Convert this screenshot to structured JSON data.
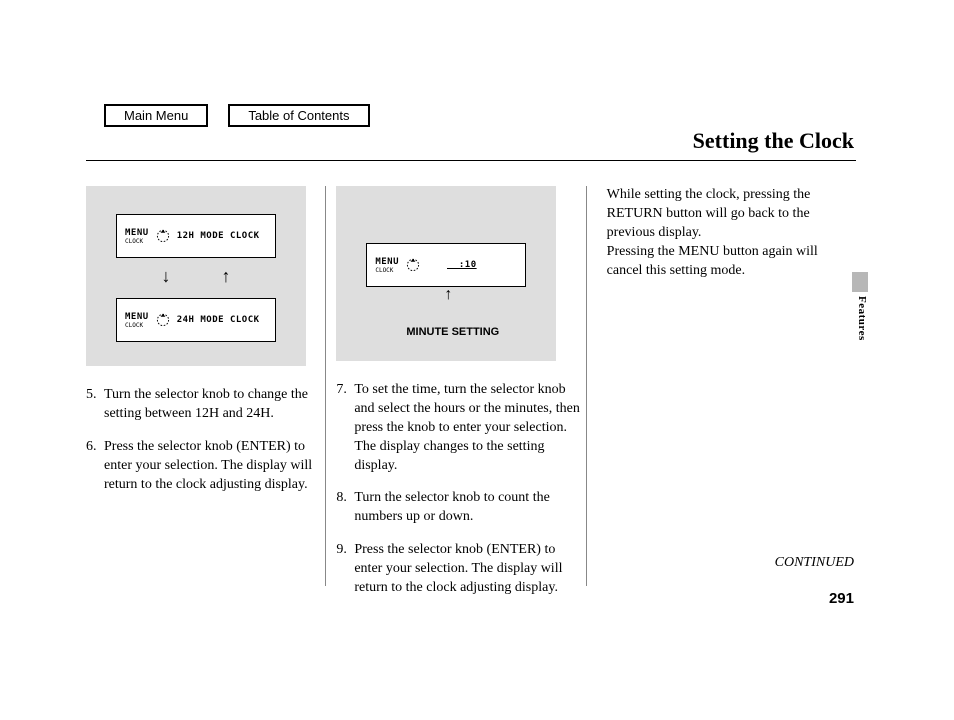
{
  "nav": {
    "main_menu": "Main Menu",
    "toc": "Table of Contents"
  },
  "title": "Setting the Clock",
  "figure1": {
    "menu_lbl": "MENU",
    "menu_sub": "CLOCK",
    "panel_a": "12H MODE CLOCK",
    "panel_b": "24H MODE CLOCK"
  },
  "figure2": {
    "menu_lbl": "MENU",
    "menu_sub": "CLOCK",
    "time": "__:10",
    "callout": "MINUTE SETTING"
  },
  "step5": {
    "n": "5.",
    "t": "Turn the selector knob to change the setting between 12H and 24H."
  },
  "step6": {
    "n": "6.",
    "t": "Press the selector knob (ENTER) to enter your selection. The display will return to the clock adjusting display."
  },
  "step7": {
    "n": "7.",
    "t": "To set the time, turn the selector knob and select the hours or the minutes, then press the knob to enter your selection. The display changes to the setting display."
  },
  "step8": {
    "n": "8.",
    "t": "Turn the selector knob to count the numbers up or down."
  },
  "step9": {
    "n": "9.",
    "t": "Press the selector knob (ENTER) to enter your selection. The display will return to the clock adjusting display."
  },
  "para3": "While setting the clock, pressing the RETURN button will go back to the previous display.\nPressing the MENU button again will cancel this setting mode.",
  "continued": "CONTINUED",
  "page": "291",
  "section": "Features"
}
